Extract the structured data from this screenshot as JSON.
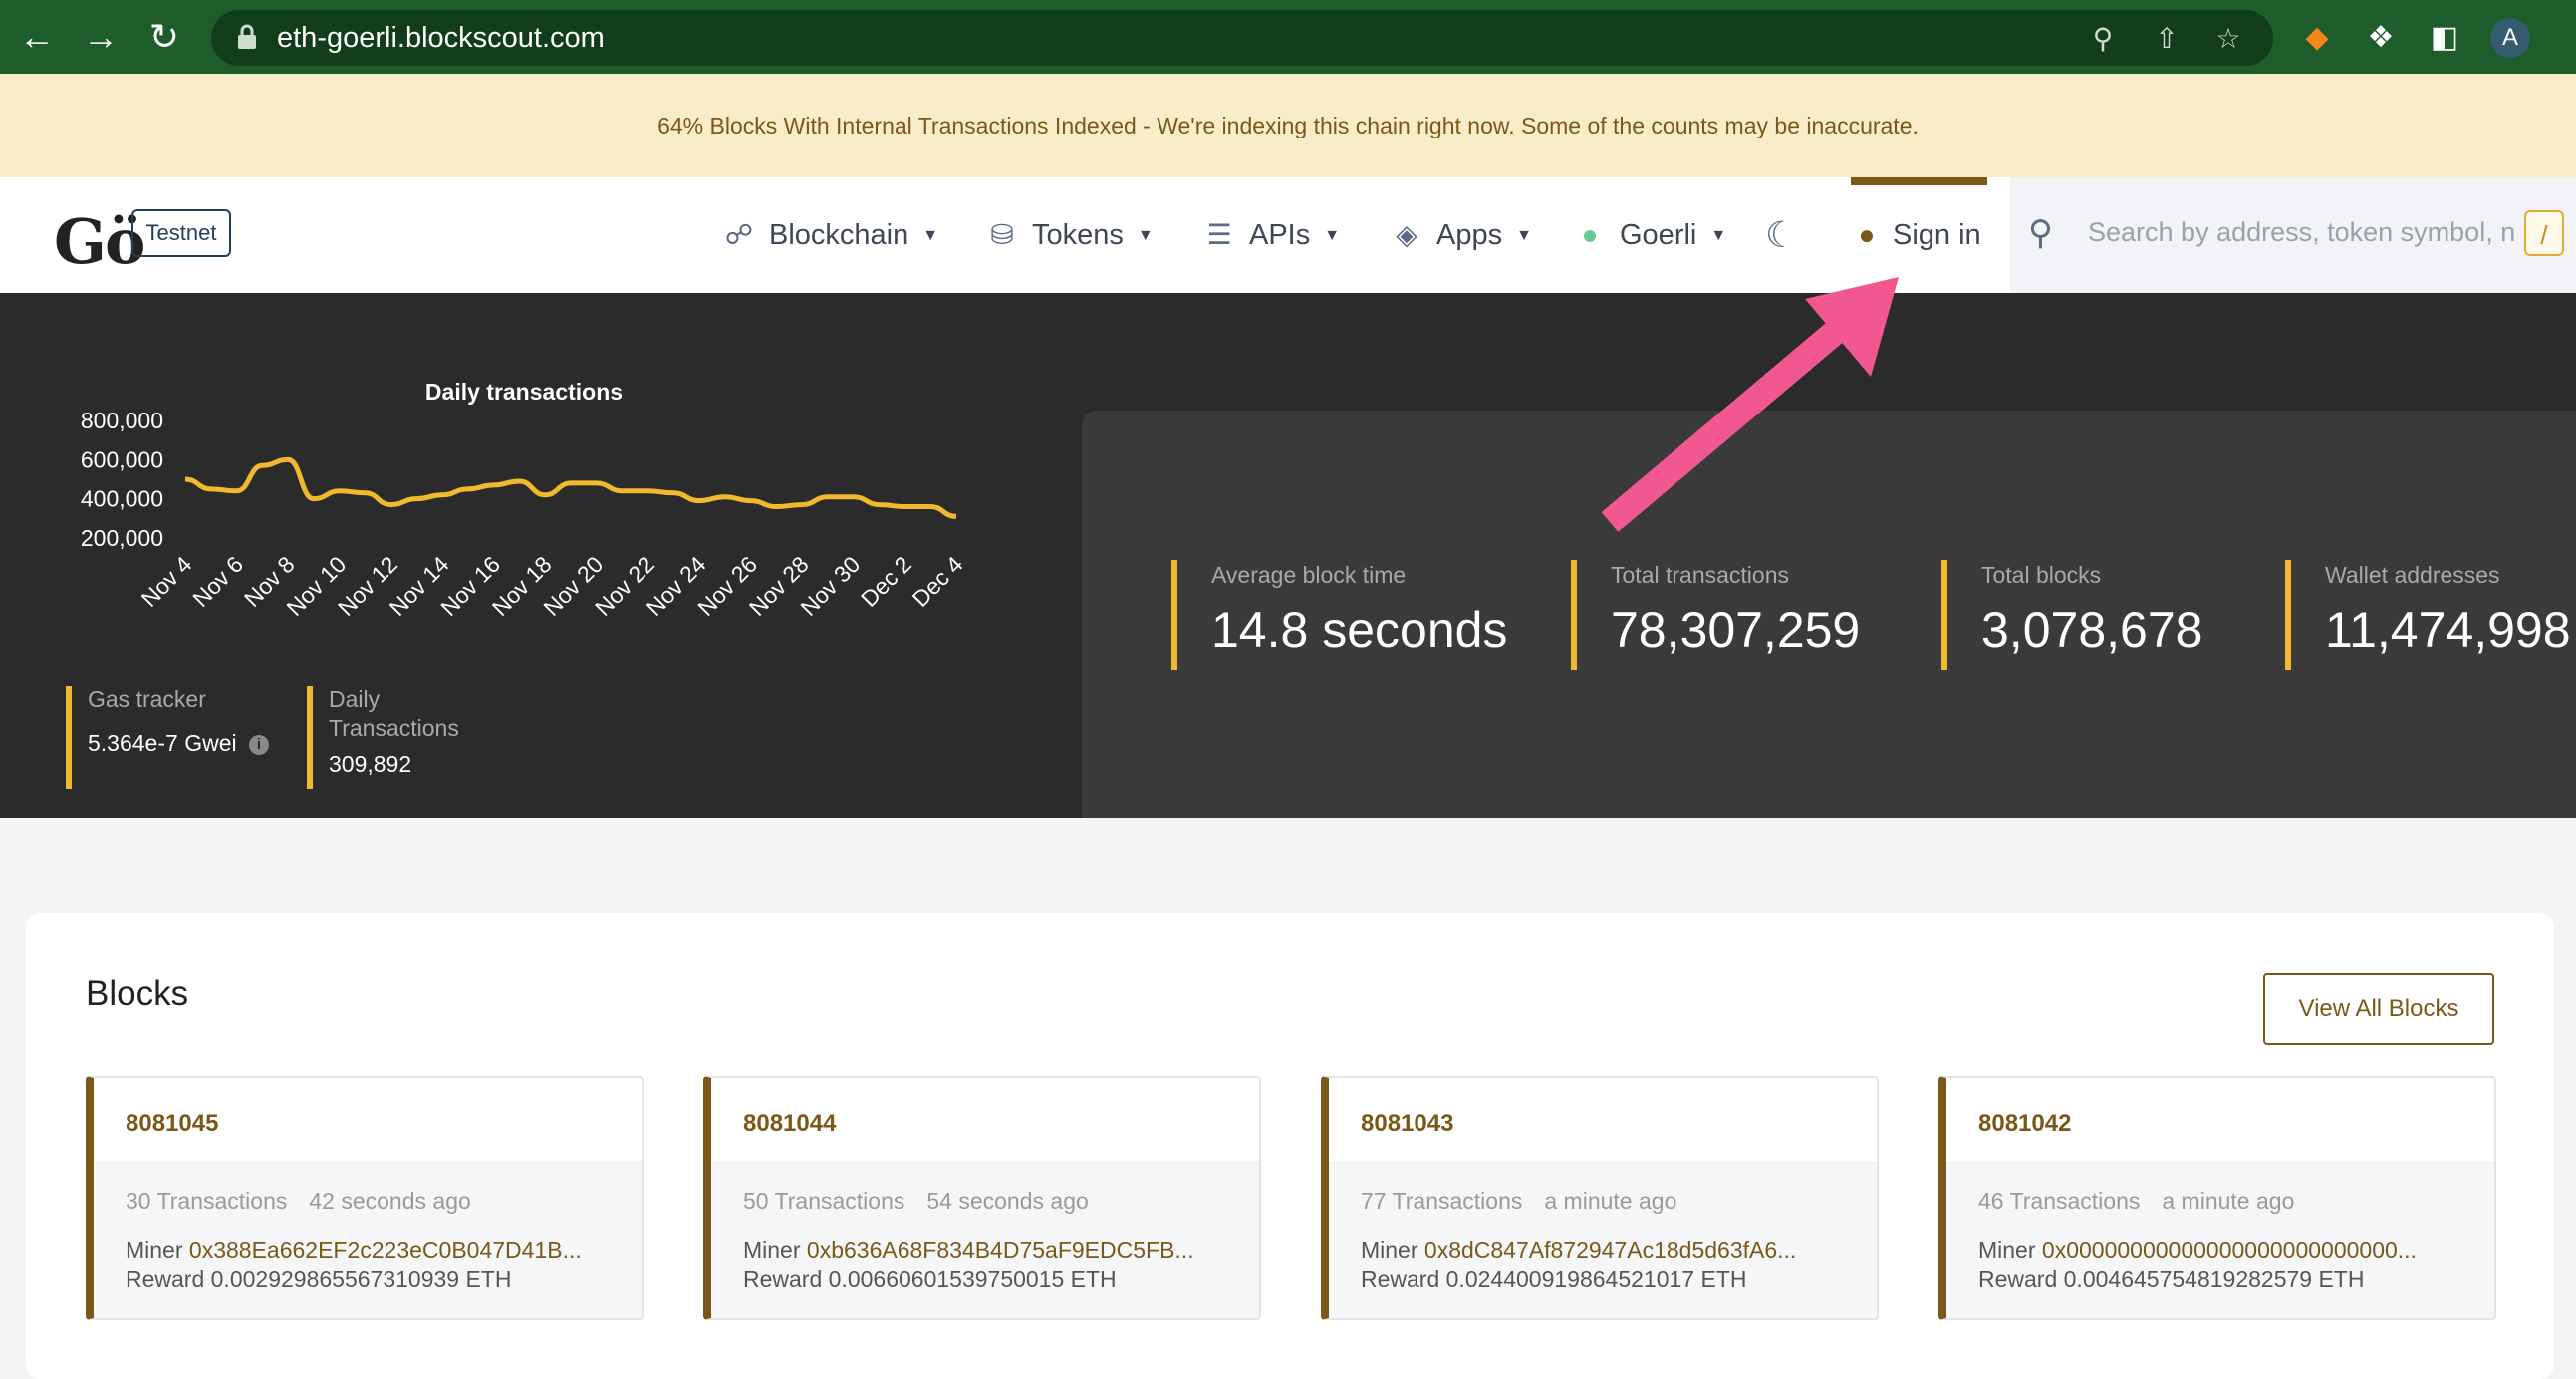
{
  "browser": {
    "url": "eth-goerli.blockscout.com",
    "profile_initial": "A"
  },
  "banner": {
    "text": "64% Blocks With Internal Transactions Indexed - We're indexing this chain right now. Some of the counts may be inaccurate."
  },
  "header": {
    "logo": "Gö",
    "network_badge": "Testnet",
    "nav": {
      "blockchain": "Blockchain",
      "tokens": "Tokens",
      "apis": "APIs",
      "apps": "Apps",
      "network": "Goerli",
      "sign_in": "Sign in"
    },
    "search": {
      "placeholder": "Search by address, token symbol, n",
      "shortcut": "/"
    }
  },
  "dashboard": {
    "gas_tracker": {
      "label": "Gas tracker",
      "value": "5.364e-7 Gwei"
    },
    "daily_transactions": {
      "label_line1": "Daily",
      "label_line2": "Transactions",
      "value": "309,892"
    },
    "stats": [
      {
        "label": "Average block time",
        "value": "14.8 seconds"
      },
      {
        "label": "Total transactions",
        "value": "78,307,259"
      },
      {
        "label": "Total blocks",
        "value": "3,078,678"
      },
      {
        "label": "Wallet addresses",
        "value": "11,474,998"
      }
    ]
  },
  "chart_data": {
    "type": "line",
    "title": "Daily transactions",
    "x": [
      "Nov 4",
      "Nov 5",
      "Nov 6",
      "Nov 7",
      "Nov 8",
      "Nov 9",
      "Nov 10",
      "Nov 11",
      "Nov 12",
      "Nov 13",
      "Nov 14",
      "Nov 15",
      "Nov 16",
      "Nov 17",
      "Nov 18",
      "Nov 19",
      "Nov 20",
      "Nov 21",
      "Nov 22",
      "Nov 23",
      "Nov 24",
      "Nov 25",
      "Nov 26",
      "Nov 27",
      "Nov 28",
      "Nov 29",
      "Nov 30",
      "Dec 1",
      "Dec 2",
      "Dec 3",
      "Dec 4"
    ],
    "x_tick_labels": [
      "Nov 4",
      "Nov 6",
      "Nov 8",
      "Nov 10",
      "Nov 12",
      "Nov 14",
      "Nov 16",
      "Nov 18",
      "Nov 20",
      "Nov 22",
      "Nov 24",
      "Nov 26",
      "Nov 28",
      "Nov 30",
      "Dec 2",
      "Dec 4"
    ],
    "series": [
      {
        "values": [
          500000,
          450000,
          440000,
          570000,
          600000,
          400000,
          440000,
          430000,
          370000,
          400000,
          420000,
          450000,
          470000,
          490000,
          420000,
          480000,
          480000,
          440000,
          440000,
          430000,
          390000,
          410000,
          390000,
          360000,
          370000,
          410000,
          410000,
          370000,
          360000,
          360000,
          310000
        ]
      }
    ],
    "y_ticks": [
      "800,000",
      "600,000",
      "400,000",
      "200,000"
    ],
    "ylim": [
      200000,
      800000
    ],
    "color": "#f1b92e",
    "grid": false
  },
  "blocks": {
    "title": "Blocks",
    "view_all": "View All Blocks",
    "items": [
      {
        "number": "8081045",
        "tx": "30 Transactions",
        "age": "42 seconds ago",
        "miner_label": "Miner",
        "miner": "0x388Ea662EF2c223eC0B047D41B...",
        "reward": "Reward 0.002929865567310939 ETH"
      },
      {
        "number": "8081044",
        "tx": "50 Transactions",
        "age": "54 seconds ago",
        "miner_label": "Miner",
        "miner": "0xb636A68F834B4D75aF9EDC5FB...",
        "reward": "Reward 0.00660601539750015 ETH"
      },
      {
        "number": "8081043",
        "tx": "77 Transactions",
        "age": "a minute ago",
        "miner_label": "Miner",
        "miner": "0x8dC847Af872947Ac18d5d63fA6...",
        "reward": "Reward 0.024400919864521017 ETH"
      },
      {
        "number": "8081042",
        "tx": "46 Transactions",
        "age": "a minute ago",
        "miner_label": "Miner",
        "miner": "0x00000000000000000000000000...",
        "reward": "Reward 0.004645754819282579 ETH"
      }
    ]
  },
  "colors": {
    "accent": "#7a5818",
    "highlight": "#f1b92e",
    "annotation_arrow": "#f0588f"
  }
}
